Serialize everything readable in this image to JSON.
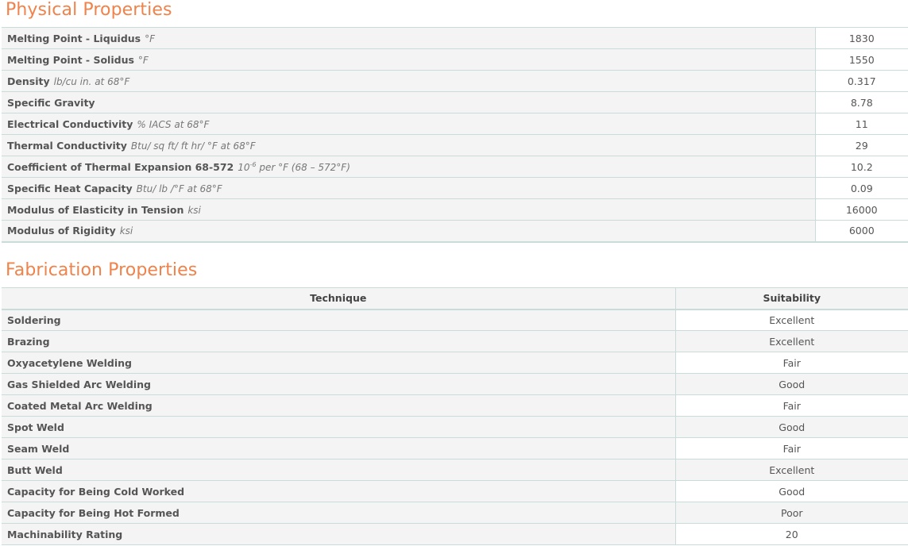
{
  "physical": {
    "title": "Physical Properties",
    "rows": [
      {
        "name": "Melting Point - Liquidus",
        "unit": "°F",
        "value": "1830"
      },
      {
        "name": "Melting Point - Solidus",
        "unit": "°F",
        "value": "1550"
      },
      {
        "name": "Density",
        "unit": "lb/cu in. at 68°F",
        "value": "0.317"
      },
      {
        "name": "Specific Gravity",
        "unit": "",
        "value": "8.78"
      },
      {
        "name": "Electrical Conductivity",
        "unit": "% IACS at 68°F",
        "value": "11"
      },
      {
        "name": "Thermal Conductivity",
        "unit": "Btu/ sq ft/ ft hr/ °F at 68°F",
        "value": "29"
      },
      {
        "name": "Coefficient of Thermal Expansion 68-572",
        "unit_prefix": "10",
        "unit_sup": "-6",
        "unit": "per °F (68 – 572°F)",
        "value": "10.2"
      },
      {
        "name": "Specific Heat Capacity",
        "unit": "Btu/ lb /°F at 68°F",
        "value": "0.09"
      },
      {
        "name": "Modulus of Elasticity in Tension",
        "unit": "ksi",
        "value": "16000"
      },
      {
        "name": "Modulus of Rigidity",
        "unit": "ksi",
        "value": "6000"
      }
    ]
  },
  "fabrication": {
    "title": "Fabrication Properties",
    "headers": {
      "technique": "Technique",
      "suitability": "Suitability"
    },
    "rows": [
      {
        "technique": "Soldering",
        "suitability": "Excellent"
      },
      {
        "technique": "Brazing",
        "suitability": "Excellent"
      },
      {
        "technique": "Oxyacetylene Welding",
        "suitability": "Fair"
      },
      {
        "technique": "Gas Shielded Arc Welding",
        "suitability": "Good"
      },
      {
        "technique": "Coated Metal Arc Welding",
        "suitability": "Fair"
      },
      {
        "technique": "Spot Weld",
        "suitability": "Good"
      },
      {
        "technique": "Seam Weld",
        "suitability": "Fair"
      },
      {
        "technique": "Butt Weld",
        "suitability": "Excellent"
      },
      {
        "technique": "Capacity for Being Cold Worked",
        "suitability": "Good"
      },
      {
        "technique": "Capacity for Being Hot Formed",
        "suitability": "Poor"
      },
      {
        "technique": "Machinability Rating",
        "suitability": "20"
      }
    ]
  }
}
